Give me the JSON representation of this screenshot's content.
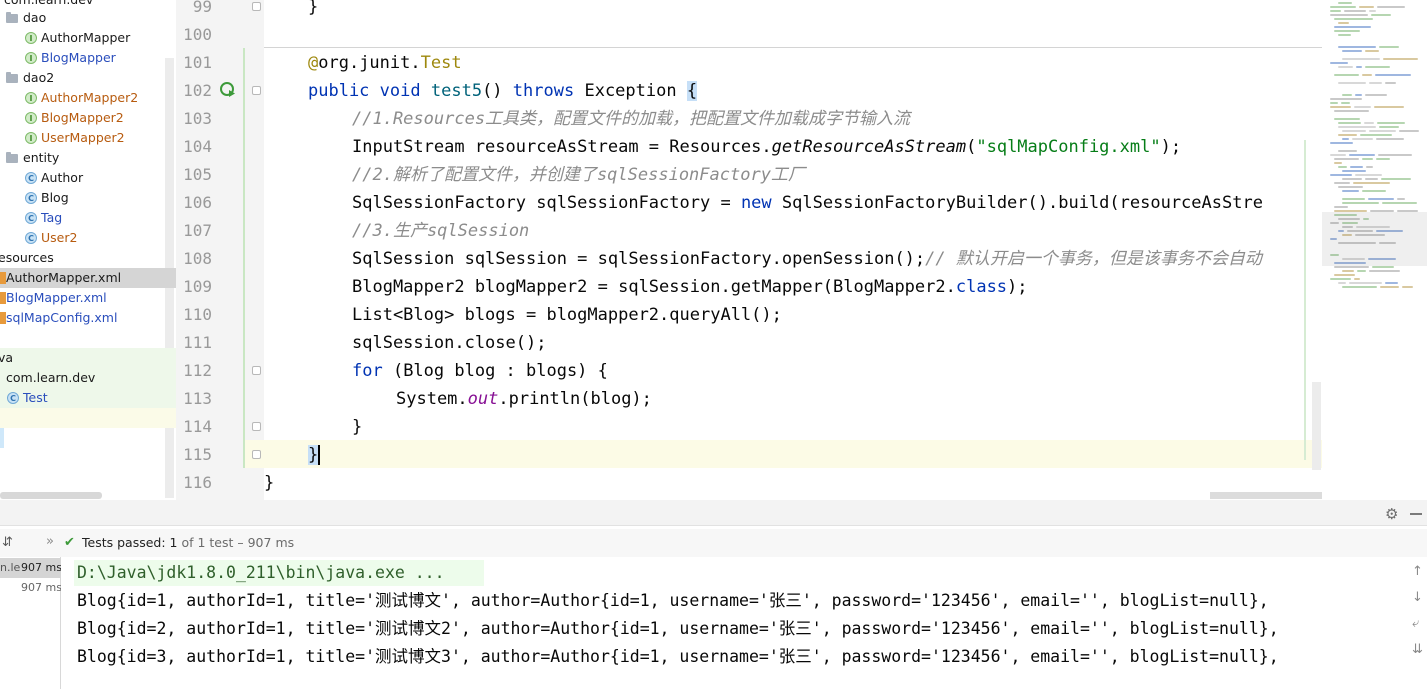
{
  "project_tree": {
    "items": [
      {
        "label": "com.learn.dev",
        "kind": "package"
      },
      {
        "label": "dao",
        "kind": "folder"
      },
      {
        "label": "AuthorMapper",
        "kind": "interface",
        "color": "dark"
      },
      {
        "label": "BlogMapper",
        "kind": "interface",
        "color": "blue"
      },
      {
        "label": "dao2",
        "kind": "folder"
      },
      {
        "label": "AuthorMapper2",
        "kind": "interface",
        "color": "orange"
      },
      {
        "label": "BlogMapper2",
        "kind": "interface",
        "color": "orange"
      },
      {
        "label": "UserMapper2",
        "kind": "interface",
        "color": "orange"
      },
      {
        "label": "entity",
        "kind": "folder"
      },
      {
        "label": "Author",
        "kind": "class",
        "color": "dark"
      },
      {
        "label": "Blog",
        "kind": "class",
        "color": "dark"
      },
      {
        "label": "Tag",
        "kind": "class",
        "color": "blue"
      },
      {
        "label": "User2",
        "kind": "class",
        "color": "orange"
      },
      {
        "label": "esources",
        "kind": "folder-text"
      },
      {
        "label": "AuthorMapper.xml",
        "kind": "xml",
        "color": "dark"
      },
      {
        "label": "BlogMapper.xml",
        "kind": "xml",
        "color": "blue"
      },
      {
        "label": "sqlMapConfig.xml",
        "kind": "xml",
        "color": "blue"
      },
      {
        "label": "",
        "kind": "blank"
      },
      {
        "label": "va",
        "kind": "text"
      },
      {
        "label": "com.learn.dev",
        "kind": "package"
      },
      {
        "label": "Test",
        "kind": "test-class",
        "color": "blue"
      }
    ]
  },
  "editor": {
    "line_numbers": [
      "99",
      "100",
      "101",
      "102",
      "103",
      "104",
      "105",
      "106",
      "107",
      "108",
      "109",
      "110",
      "111",
      "112",
      "113",
      "114",
      "115",
      "116"
    ],
    "code": {
      "l99": "}",
      "l101_at": "@",
      "l101_pkg": "org.junit.",
      "l101_test": "Test",
      "l102_public": "public",
      "l102_void": "void",
      "l102_name": "test5",
      "l102_paren": "()",
      "l102_throws": "throws",
      "l102_exc": "Exception",
      "l102_brace": "{",
      "l103": "//1.Resources工具类，配置文件的加载，把配置文件加载成字节输入流",
      "l104_a": "InputStream resourceAsStream = Resources.",
      "l104_m": "getResourceAsStream",
      "l104_b": "(",
      "l104_s": "\"sqlMapConfig.xml\"",
      "l104_c": ");",
      "l105": "//2.解析了配置文件，并创建了sqlSessionFactory工厂",
      "l106_a": "SqlSessionFactory sqlSessionFactory = ",
      "l106_new": "new",
      "l106_b": " SqlSessionFactoryBuilder().build(resourceAsStre",
      "l107": "//3.生产sqlSession",
      "l108_a": "SqlSession sqlSession = sqlSessionFactory.openSession();",
      "l108_cm": "// 默认开启一个事务，但是该事务不会自动",
      "l109_a": "BlogMapper2 blogMapper2 = sqlSession.getMapper(BlogMapper2.",
      "l109_cls": "class",
      "l109_b": ");",
      "l110": "List<Blog> blogs = blogMapper2.queryAll();",
      "l111": "sqlSession.close();",
      "l112_for": "for",
      "l112_b": " (Blog blog : blogs) {",
      "l113_a": "System.",
      "l113_out": "out",
      "l113_b": ".println(blog);",
      "l114": "}",
      "l115": "}",
      "l116": "}"
    }
  },
  "run_panel": {
    "status_prefix": "Tests passed: ",
    "status_count": "1",
    "status_suffix": " of 1 test – 907 ms",
    "test_tree": [
      {
        "name": "n.le",
        "time": "907 ms"
      },
      {
        "name": "",
        "time": "907 ms"
      }
    ],
    "console": [
      "D:\\Java\\jdk1.8.0_211\\bin\\java.exe ...",
      "Blog{id=1, authorId=1, title='测试博文', author=Author{id=1, username='张三', password='123456', email='', blogList=null},",
      "Blog{id=2, authorId=1, title='测试博文2', author=Author{id=1, username='张三', password='123456', email='', blogList=null},",
      "Blog{id=3, authorId=1, title='测试博文3', author=Author{id=1, username='张三', password='123456', email='', blogList=null},"
    ]
  },
  "colors": {
    "keyword": "#0033b3",
    "string": "#067d17",
    "comment": "#8c8c8c",
    "annotation": "#9e880d",
    "method": "#00627a",
    "field": "#871094",
    "tests_passed": "#3d9a3a"
  }
}
